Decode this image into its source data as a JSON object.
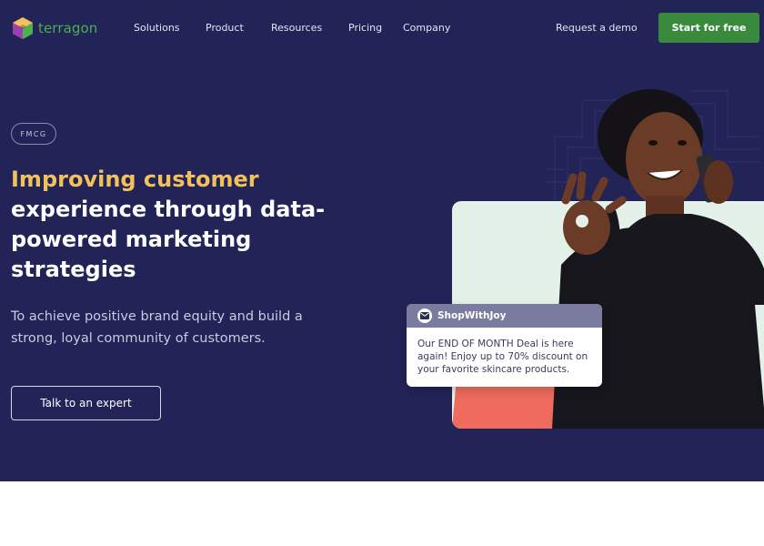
{
  "brand": {
    "name": "terragon"
  },
  "nav": {
    "items": [
      {
        "label": "Solutions"
      },
      {
        "label": "Product"
      },
      {
        "label": "Resources"
      },
      {
        "label": "Pricing"
      },
      {
        "label": "Company"
      }
    ],
    "request_demo": "Request a demo",
    "start_free": "Start for free"
  },
  "hero": {
    "tag": "FMCG",
    "headline_highlight": "Improving customer",
    "headline_rest": "experience through data-powered marketing strategies",
    "subtitle": "To achieve positive brand equity and build a strong, loyal community of customers.",
    "cta": "Talk to an expert"
  },
  "notification": {
    "icon": "envelope-icon",
    "sender": "ShopWithJoy",
    "message": "Our END OF MONTH Deal is here again! Enjoy up to 70% discount on your favorite skincare products."
  },
  "colors": {
    "hero_bg": "#222357",
    "accent_yellow": "#f3c15b",
    "brand_green": "#3a8a3e",
    "card_bg": "#e3f1e9",
    "notif_header": "#7b7b9f"
  }
}
